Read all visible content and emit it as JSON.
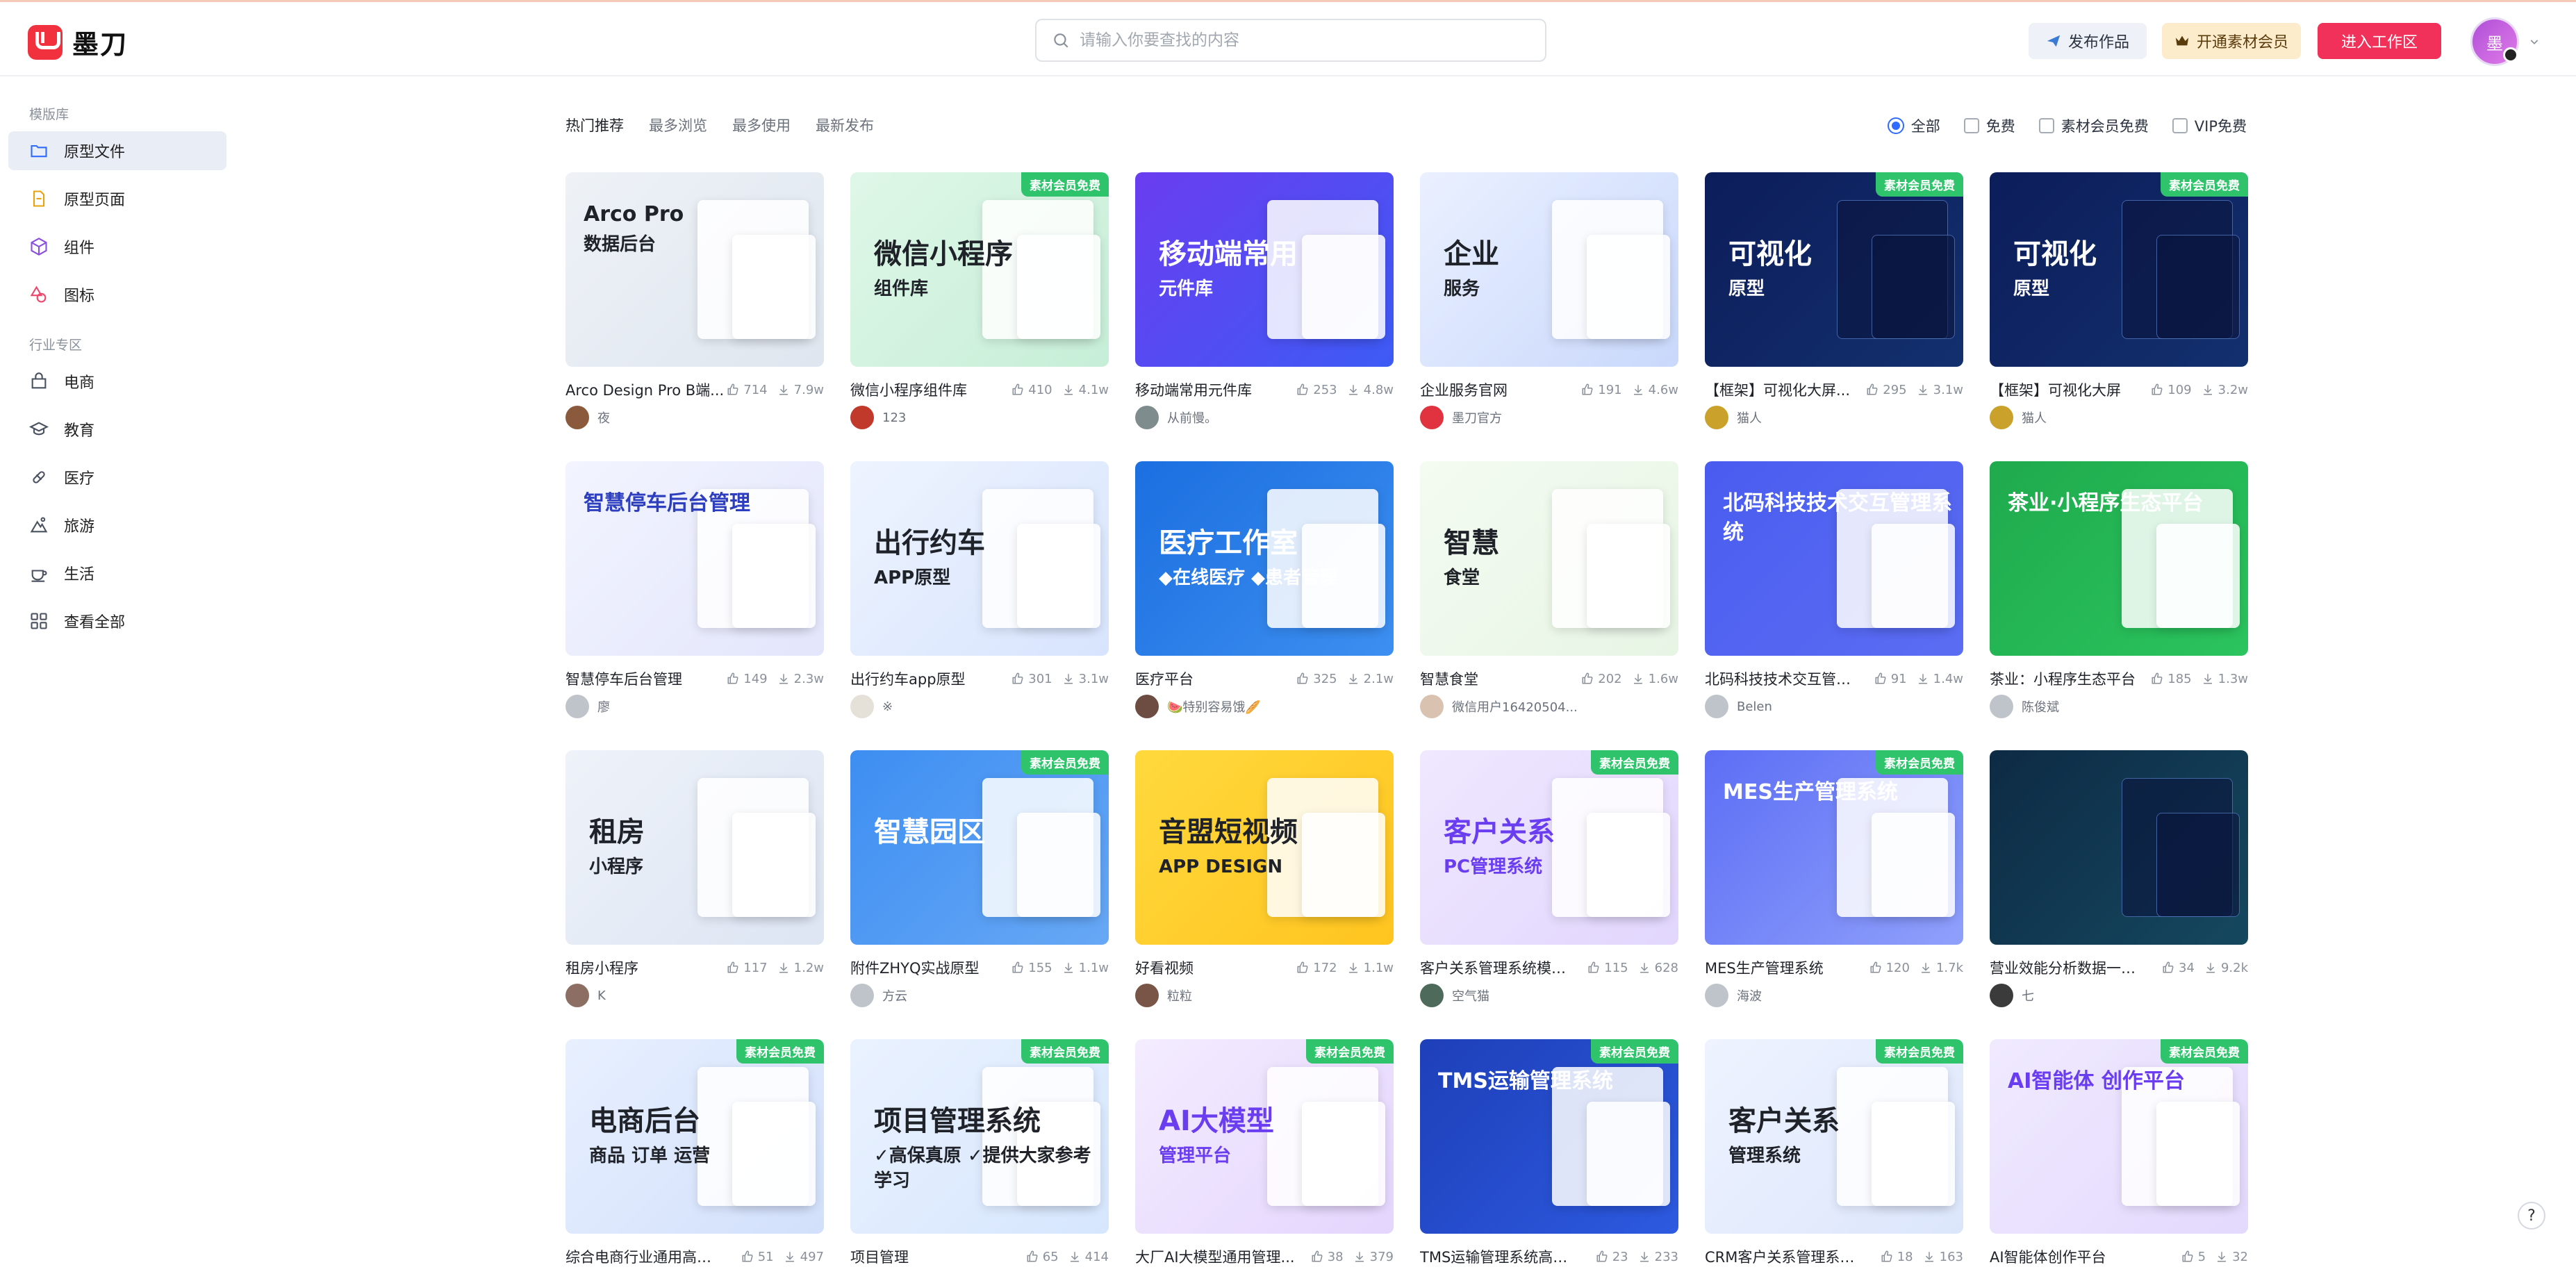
{
  "app": {
    "logo_text": "墨刀"
  },
  "header": {
    "search_placeholder": "请输入你要查找的内容",
    "publish_label": "发布作品",
    "vip_label": "开通素材会员",
    "enter_label": "进入工作区",
    "avatar_text": "墨"
  },
  "sidebar": {
    "section1": "模版库",
    "items1": [
      {
        "label": "原型文件",
        "icon": "folder-icon"
      },
      {
        "label": "原型页面",
        "icon": "page-icon"
      },
      {
        "label": "组件",
        "icon": "cube-icon"
      },
      {
        "label": "图标",
        "icon": "shapes-icon"
      }
    ],
    "section2": "行业专区",
    "items2": [
      {
        "label": "电商",
        "icon": "shop-icon"
      },
      {
        "label": "教育",
        "icon": "education-icon"
      },
      {
        "label": "医疗",
        "icon": "medical-icon"
      },
      {
        "label": "旅游",
        "icon": "travel-icon"
      },
      {
        "label": "生活",
        "icon": "life-icon"
      },
      {
        "label": "查看全部",
        "icon": "grid-icon"
      }
    ]
  },
  "tabs": [
    "热门推荐",
    "最多浏览",
    "最多使用",
    "最新发布"
  ],
  "filters": {
    "all": "全部",
    "free": "免费",
    "material_free": "素材会员免费",
    "vip_free": "VIP免费"
  },
  "vip_tag": "素材会员免费",
  "cards": [
    {
      "title": "Arco Design Pro B端...",
      "likes": "714",
      "downloads": "7.9w",
      "author": "夜",
      "thumb_t1": "Arco Pro",
      "thumb_t2": "数据后台",
      "vip": false
    },
    {
      "title": "微信小程序组件库",
      "likes": "410",
      "downloads": "4.1w",
      "author": "123",
      "thumb_t1": "微信小程序",
      "thumb_t2": "组件库",
      "vip": true
    },
    {
      "title": "移动端常用元件库",
      "likes": "253",
      "downloads": "4.8w",
      "author": "从前慢。",
      "thumb_t1": "移动端常用",
      "thumb_t2": "元件库",
      "vip": false
    },
    {
      "title": "企业服务官网",
      "likes": "191",
      "downloads": "4.6w",
      "author": "墨刀官方",
      "thumb_t1": "企业",
      "thumb_t2": "服务",
      "vip": false
    },
    {
      "title": "【框架】可视化大屏...",
      "likes": "295",
      "downloads": "3.1w",
      "author": "猫人",
      "thumb_t1": "可视化",
      "thumb_t2": "原型",
      "vip": true
    },
    {
      "title": "【框架】可视化大屏",
      "likes": "109",
      "downloads": "3.2w",
      "author": "猫人",
      "thumb_t1": "可视化",
      "thumb_t2": "原型",
      "vip": true
    },
    {
      "title": "智慧停车后台管理",
      "likes": "149",
      "downloads": "2.3w",
      "author": "廖",
      "thumb_t1": "智慧停车后台管理",
      "thumb_t2": "",
      "vip": false
    },
    {
      "title": "出行约车app原型",
      "likes": "301",
      "downloads": "3.1w",
      "author": "※",
      "thumb_t1": "出行约车",
      "thumb_t2": "APP原型",
      "vip": false
    },
    {
      "title": "医疗平台",
      "likes": "325",
      "downloads": "2.1w",
      "author": "🍉特别容易饿🥖",
      "thumb_t1": "医疗工作室",
      "thumb_t2": "◆在线医疗 ◆患者管理",
      "vip": false
    },
    {
      "title": "智慧食堂",
      "likes": "202",
      "downloads": "1.6w",
      "author": "微信用户16420504...",
      "thumb_t1": "智慧",
      "thumb_t2": "食堂",
      "vip": false
    },
    {
      "title": "北码科技技术交互管理...",
      "likes": "91",
      "downloads": "1.4w",
      "author": "Belen",
      "thumb_t1": "北码科技技术交互管理系统",
      "thumb_t2": "",
      "vip": false
    },
    {
      "title": "茶业：小程序生态平台",
      "likes": "185",
      "downloads": "1.3w",
      "author": "陈俊斌",
      "thumb_t1": "茶业·小程序生态平台",
      "thumb_t2": "",
      "vip": false
    },
    {
      "title": "租房小程序",
      "likes": "117",
      "downloads": "1.2w",
      "author": "K",
      "thumb_t1": "租房",
      "thumb_t2": "小程序",
      "vip": false
    },
    {
      "title": "附件ZHYQ实战原型",
      "likes": "155",
      "downloads": "1.1w",
      "author": "方云",
      "thumb_t1": "智慧园区",
      "thumb_t2": "",
      "vip": true
    },
    {
      "title": "好看视频",
      "likes": "172",
      "downloads": "1.1w",
      "author": "粒粒",
      "thumb_t1": "音盟短视频",
      "thumb_t2": "APP DESIGN",
      "vip": false
    },
    {
      "title": "客户关系管理系统模板...",
      "likes": "115",
      "downloads": "628",
      "author": "空气猫",
      "thumb_t1": "客户关系",
      "thumb_t2": "PC管理系统",
      "vip": true
    },
    {
      "title": "MES生产管理系统",
      "likes": "120",
      "downloads": "1.7k",
      "author": "海波",
      "thumb_t1": "MES生产管理系统",
      "thumb_t2": "",
      "vip": true
    },
    {
      "title": "营业效能分析数据一张...",
      "likes": "34",
      "downloads": "9.2k",
      "author": "七",
      "thumb_t1": "",
      "thumb_t2": "",
      "vip": false
    },
    {
      "title": "综合电商行业通用高保...",
      "likes": "51",
      "downloads": "497",
      "author": "",
      "thumb_t1": "电商后台",
      "thumb_t2": "商品 订单 运营",
      "vip": true
    },
    {
      "title": "项目管理",
      "likes": "65",
      "downloads": "414",
      "author": "",
      "thumb_t1": "项目管理系统",
      "thumb_t2": "✓高保真原 ✓提供大家参考学习",
      "vip": true
    },
    {
      "title": "大厂AI大模型通用管理...",
      "likes": "38",
      "downloads": "379",
      "author": "",
      "thumb_t1": "AI大模型",
      "thumb_t2": "管理平台",
      "vip": true
    },
    {
      "title": "TMS运输管理系统高保...",
      "likes": "23",
      "downloads": "233",
      "author": "",
      "thumb_t1": "TMS运输管理系统",
      "thumb_t2": "",
      "vip": true
    },
    {
      "title": "CRM客户关系管理系统...",
      "likes": "18",
      "downloads": "163",
      "author": "",
      "thumb_t1": "客户关系",
      "thumb_t2": "管理系统",
      "vip": true
    },
    {
      "title": "AI智能体创作平台",
      "likes": "5",
      "downloads": "32",
      "author": "",
      "thumb_t1": "AI智能体 创作平台",
      "thumb_t2": "",
      "vip": true
    }
  ],
  "help_label": "?"
}
